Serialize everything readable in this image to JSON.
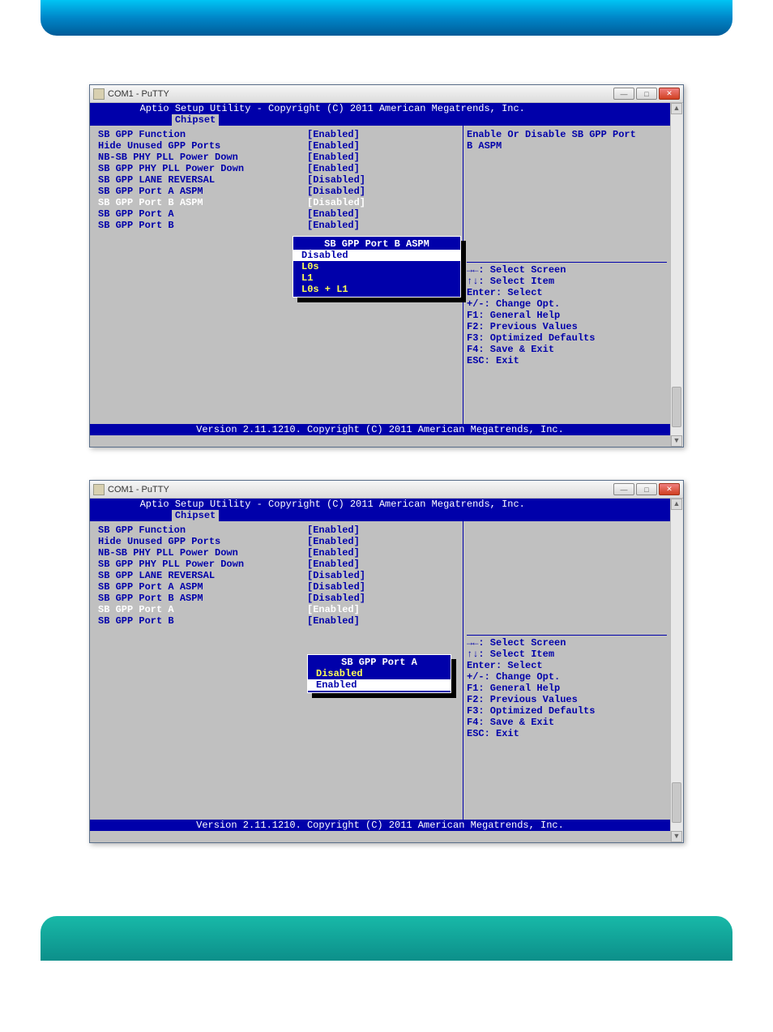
{
  "window": {
    "title": "COM1 - PuTTY"
  },
  "bios": {
    "header": "Aptio Setup Utility - Copyright (C) 2011 American Megatrends, Inc.",
    "tab": "Chipset",
    "footer": "Version 2.11.1210. Copyright (C) 2011 American Megatrends, Inc."
  },
  "settings": [
    {
      "label": "SB GPP Function",
      "value": "[Enabled]"
    },
    {
      "label": "Hide Unused GPP Ports",
      "value": "[Enabled]"
    },
    {
      "label": "NB-SB PHY PLL Power Down",
      "value": "[Enabled]"
    },
    {
      "label": "SB GPP PHY PLL Power Down",
      "value": "[Enabled]"
    },
    {
      "label": "SB GPP LANE REVERSAL",
      "value": "[Disabled]"
    },
    {
      "label": "SB GPP Port A ASPM",
      "value": "[Disabled]"
    },
    {
      "label": "SB GPP Port B ASPM",
      "value": "[Disabled]"
    },
    {
      "label": "SB GPP Port A",
      "value": "[Enabled]"
    },
    {
      "label": "SB GPP Port B",
      "value": "[Enabled]"
    }
  ],
  "screenshot1": {
    "selected_index": 6,
    "help_line1": "Enable Or Disable SB GPP Port",
    "help_line2": "B ASPM",
    "popup": {
      "title": " SB GPP Port B ASPM ",
      "options": [
        "Disabled",
        "L0s",
        "L1",
        "L0s + L1"
      ],
      "selected": 0
    }
  },
  "screenshot2": {
    "selected_index": 7,
    "help_line1": "",
    "help_line2": "",
    "popup": {
      "title": " SB GPP Port A ",
      "options": [
        "Disabled",
        "Enabled"
      ],
      "selected": 1
    }
  },
  "nav": [
    "→←: Select Screen",
    "↑↓: Select Item",
    "Enter: Select",
    "+/-: Change Opt.",
    "F1: General Help",
    "F2: Previous Values",
    "F3: Optimized Defaults",
    "F4: Save & Exit",
    "ESC: Exit"
  ]
}
